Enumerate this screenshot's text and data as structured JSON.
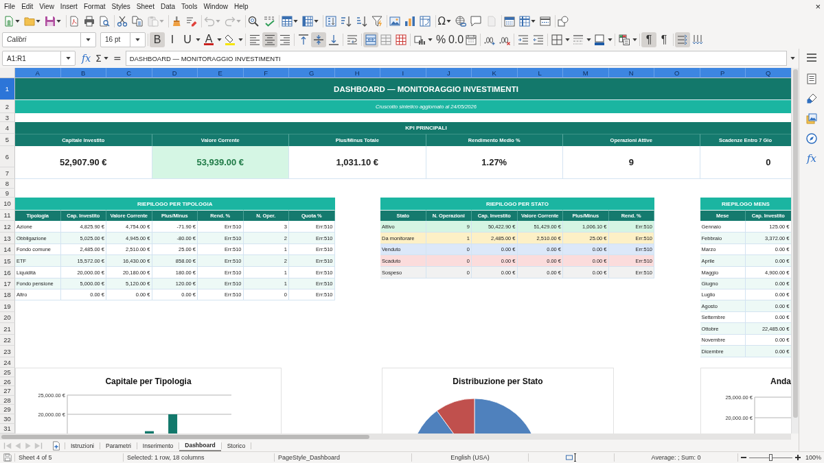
{
  "menu_bar": {
    "items": [
      "File",
      "Edit",
      "View",
      "Insert",
      "Format",
      "Styles",
      "Sheet",
      "Data",
      "Tools",
      "Window",
      "Help"
    ],
    "close": "×"
  },
  "standard_toolbar": {
    "buttons": [
      {
        "disabled": false
      },
      {
        "disabled": false
      },
      {
        "disabled": false
      },
      {
        "disabled": false
      },
      {
        "disabled": false
      },
      {
        "disabled": false
      },
      {
        "disabled": false
      },
      {
        "disabled": false
      },
      {
        "disabled": true
      },
      {
        "disabled": false
      },
      {
        "disabled": false
      },
      {
        "disabled": true
      },
      {
        "disabled": true
      },
      {
        "disabled": false
      },
      {
        "disabled": false
      },
      {
        "disabled": false
      },
      {
        "disabled": false
      },
      {
        "disabled": false
      },
      {
        "disabled": false
      },
      {
        "disabled": false
      },
      {
        "disabled": false
      },
      {
        "disabled": false
      },
      {
        "disabled": false
      },
      {
        "disabled": false
      },
      {
        "label": "Ω",
        "disabled": false
      },
      {
        "disabled": false
      },
      {
        "disabled": false
      },
      {
        "disabled": true
      },
      {
        "disabled": false
      },
      {
        "disabled": false
      },
      {
        "disabled": false
      },
      {
        "disabled": false
      }
    ]
  },
  "formatting_toolbar": {
    "font_name": "Calibri",
    "font_size": "16 pt",
    "buttons": [
      {
        "label": "B",
        "pressed": true
      },
      {
        "label": "I",
        "pressed": false
      },
      {
        "label": "U",
        "pressed": false
      },
      {
        "label": "A",
        "pressed": false
      },
      {
        "pressed": false
      },
      {
        "pressed": false
      },
      {
        "pressed": true
      },
      {
        "pressed": false
      },
      {
        "pressed": false
      },
      {
        "pressed": true
      },
      {
        "pressed": false
      },
      {
        "pressed": false
      },
      {
        "pressed": true
      },
      {
        "pressed": false
      },
      {
        "pressed": false
      },
      {
        "pressed": false
      },
      {
        "label": "%",
        "pressed": false
      },
      {
        "label": "0.0",
        "pressed": false
      },
      {
        "pressed": false
      },
      {
        "pressed": false
      },
      {
        "pressed": false
      },
      {
        "pressed": false
      },
      {
        "pressed": false
      },
      {
        "pressed": false
      },
      {
        "pressed": false
      },
      {
        "pressed": false
      },
      {
        "pressed": false
      },
      {
        "label": "¶",
        "pressed": true
      },
      {
        "label": "¶",
        "pressed": false
      },
      {
        "pressed": true
      },
      {
        "pressed": false
      }
    ]
  },
  "formula_bar": {
    "name_box": "A1:R1",
    "symbols": [
      "fx",
      "Σ",
      "="
    ],
    "content": "DASHBOARD — MONITORAGGIO INVESTIMENTI"
  },
  "sheet": {
    "columns": [
      {
        "label": "A",
        "selected": true
      },
      {
        "label": "B",
        "selected": true
      },
      {
        "label": "C",
        "selected": true
      },
      {
        "label": "D",
        "selected": true
      },
      {
        "label": "E",
        "selected": true
      },
      {
        "label": "F",
        "selected": true
      },
      {
        "label": "G",
        "selected": true
      },
      {
        "label": "H",
        "selected": true
      },
      {
        "label": "I",
        "selected": true
      },
      {
        "label": "J",
        "selected": true
      },
      {
        "label": "K",
        "selected": true
      },
      {
        "label": "L",
        "selected": true
      },
      {
        "label": "M",
        "selected": true
      },
      {
        "label": "N",
        "selected": true
      },
      {
        "label": "O",
        "selected": true
      },
      {
        "label": "P",
        "selected": true
      },
      {
        "label": "Q",
        "selected": true
      }
    ],
    "rows": [
      {
        "label": "1",
        "selected": true
      },
      {
        "label": "2",
        "selected": false
      },
      {
        "label": "3",
        "selected": false
      },
      {
        "label": "4",
        "selected": false
      },
      {
        "label": "5",
        "selected": false
      },
      {
        "label": "6",
        "selected": false
      },
      {
        "label": "7",
        "selected": false
      },
      {
        "label": "8",
        "selected": false
      },
      {
        "label": "9",
        "selected": false
      },
      {
        "label": "10",
        "selected": false
      },
      {
        "label": "11",
        "selected": false
      },
      {
        "label": "12",
        "selected": false
      },
      {
        "label": "13",
        "selected": false
      },
      {
        "label": "14",
        "selected": false
      },
      {
        "label": "15",
        "selected": false
      },
      {
        "label": "16",
        "selected": false
      },
      {
        "label": "17",
        "selected": false
      },
      {
        "label": "18",
        "selected": false
      },
      {
        "label": "19",
        "selected": false
      },
      {
        "label": "20",
        "selected": false
      },
      {
        "label": "21",
        "selected": false
      },
      {
        "label": "22",
        "selected": false
      },
      {
        "label": "23",
        "selected": false
      },
      {
        "label": "24",
        "selected": false
      },
      {
        "label": "25",
        "selected": false
      },
      {
        "label": "26",
        "selected": false
      },
      {
        "label": "27",
        "selected": false
      },
      {
        "label": "28",
        "selected": false
      },
      {
        "label": "29",
        "selected": false
      },
      {
        "label": "30",
        "selected": false
      },
      {
        "label": "31",
        "selected": false
      }
    ],
    "title": "DASHBOARD — MONITORAGGIO INVESTIMENTI",
    "subtitle": "Cruscotto sintetico aggiornato al 24/05/2026",
    "kpi_title": "KPI PRINCIPALI",
    "kpis": [
      {
        "label": "Capitale Investito",
        "value": "52,907.90 €",
        "highlighted": false
      },
      {
        "label": "Valore Corrente",
        "value": "53,939.00 €",
        "highlighted": true
      },
      {
        "label": "Plus/Minus Totale",
        "value": "1,031.10 €",
        "highlighted": false
      },
      {
        "label": "Rendimento Medio %",
        "value": "1.27%",
        "highlighted": false
      },
      {
        "label": "Operazioni Attive",
        "value": "9",
        "highlighted": false
      },
      {
        "label": "Scadenze Entro 7 Gio",
        "value": "0",
        "highlighted": false
      }
    ],
    "type_summary": {
      "title": "RIEPILOGO PER TIPOLOGIA",
      "columns": [
        "Tipologia",
        "Cap. Investito",
        "Valore Corrente",
        "Plus/Minus",
        "Rend. %",
        "N. Oper.",
        "Quota %"
      ],
      "rows": [
        [
          "Azione",
          "4,825.90 €",
          "4,754.00 €",
          "-71.90 €",
          "Err:510",
          "3",
          "Err:510"
        ],
        [
          "Obbligazione",
          "5,025.00 €",
          "4,945.00 €",
          "-80.00 €",
          "Err:510",
          "2",
          "Err:510"
        ],
        [
          "Fondo comune",
          "2,485.00 €",
          "2,510.00 €",
          "25.00 €",
          "Err:510",
          "1",
          "Err:510"
        ],
        [
          "ETF",
          "15,572.00 €",
          "16,430.00 €",
          "858.00 €",
          "Err:510",
          "2",
          "Err:510"
        ],
        [
          "Liquidità",
          "20,000.00 €",
          "20,180.00 €",
          "180.00 €",
          "Err:510",
          "1",
          "Err:510"
        ],
        [
          "Fondo pensione",
          "5,000.00 €",
          "5,120.00 €",
          "120.00 €",
          "Err:510",
          "1",
          "Err:510"
        ],
        [
          "Altro",
          "0.00 €",
          "0.00 €",
          "0.00 €",
          "Err:510",
          "0",
          "Err:510"
        ]
      ]
    },
    "status_summary": {
      "title": "RIEPILOGO PER STATO",
      "columns": [
        "Stato",
        "N. Operazioni",
        "Cap. Investito",
        "Valore Corrente",
        "Plus/Minus",
        "Rend. %"
      ],
      "rows": [
        {
          "cells": [
            "Attivo",
            "9",
            "50,422.90 €",
            "51,429.00 €",
            "1,006.10 €",
            "Err:510"
          ],
          "color": "#d5f5e3"
        },
        {
          "cells": [
            "Da monitorare",
            "1",
            "2,485.00 €",
            "2,510.00 €",
            "25.00 €",
            "Err:510"
          ],
          "color": "#fdf0c6"
        },
        {
          "cells": [
            "Venduto",
            "0",
            "0.00 €",
            "0.00 €",
            "0.00 €",
            "Err:510"
          ],
          "color": "#dce8f9"
        },
        {
          "cells": [
            "Scaduto",
            "0",
            "0.00 €",
            "0.00 €",
            "0.00 €",
            "Err:510"
          ],
          "color": "#fbdcdc"
        },
        {
          "cells": [
            "Sospeso",
            "0",
            "0.00 €",
            "0.00 €",
            "0.00 €",
            "Err:510"
          ],
          "color": "#f1f1f1"
        }
      ]
    },
    "monthly_summary": {
      "title": "RIEPILOGO MENS",
      "columns": [
        "Mese",
        "Cap. Investito"
      ],
      "rows": [
        [
          "Gennaio",
          "125.00 €"
        ],
        [
          "Febbraio",
          "3,372.00 €"
        ],
        [
          "Marzo",
          "0.00 €"
        ],
        [
          "Aprile",
          "0.00 €"
        ],
        [
          "Maggio",
          "4,900.00 €"
        ],
        [
          "Giugno",
          "0.00 €"
        ],
        [
          "Luglio",
          "0.00 €"
        ],
        [
          "Agosto",
          "0.00 €"
        ],
        [
          "Settembre",
          "0.00 €"
        ],
        [
          "Ottobre",
          "22,485.00 €"
        ],
        [
          "Novembre",
          "0.00 €"
        ],
        [
          "Dicembre",
          "0.00 €"
        ]
      ]
    },
    "charts": [
      {
        "chart_data": {
          "type": "bar",
          "title": "Capitale per Tipologia",
          "categories": [
            null,
            null,
            null,
            null,
            null,
            null,
            null
          ],
          "values": [
            null,
            null,
            null,
            15600,
            20000,
            null,
            null
          ],
          "ylim": [
            15000,
            25000
          ],
          "yticks": [
            {
              "value": 20000,
              "label": "20,000.00 €"
            },
            {
              "value": 25000,
              "label": "25,000.00 €"
            }
          ]
        }
      },
      {
        "chart_data": {
          "type": "pie",
          "title": "Distribuzione per Stato",
          "values": [
            90,
            10
          ]
        }
      },
      {
        "title": "Anda",
        "tick_labels": [
          "25,000.00 €",
          "20,000.00 €"
        ]
      }
    ]
  },
  "sidebar": {
    "decks": [
      {
        "selected": false
      },
      {
        "selected": false
      },
      {
        "selected": false
      },
      {
        "selected": false
      },
      {
        "label": "fx",
        "selected": false
      }
    ]
  },
  "sheet_tabs": {
    "navigation": [
      {
        "disabled": true
      },
      {
        "disabled": true
      },
      {
        "disabled": true
      },
      {
        "disabled": true
      }
    ],
    "tabs": [
      {
        "label": "Istruzioni",
        "selected": false
      },
      {
        "label": "Parametri",
        "selected": false
      },
      {
        "label": "Inserimento",
        "selected": false
      },
      {
        "label": "Dashboard",
        "selected": true
      },
      {
        "label": "Storico",
        "selected": false
      }
    ]
  },
  "status_bar": {
    "sheet": "Sheet 4 of 5",
    "selection": "Selected: 1 row, 18 columns",
    "page_style": "PageStyle_Dashboard",
    "language": "English (USA)",
    "summary": "Average: ; Sum: 0",
    "zoom": {
      "level": 0.5,
      "reading": "100%"
    }
  }
}
